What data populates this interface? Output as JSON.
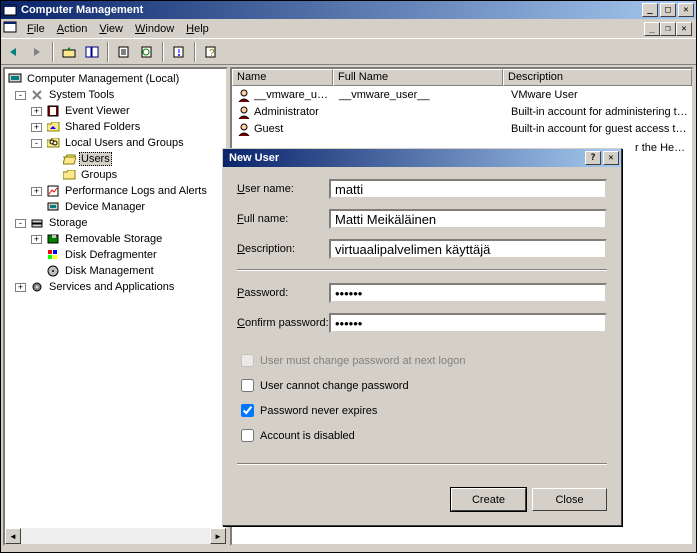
{
  "window": {
    "title": "Computer Management"
  },
  "menu": {
    "file": "File",
    "action": "Action",
    "view": "View",
    "window": "Window",
    "help": "Help"
  },
  "tree": {
    "root": "Computer Management (Local)",
    "system_tools": "System Tools",
    "event_viewer": "Event Viewer",
    "shared_folders": "Shared Folders",
    "local_users": "Local Users and Groups",
    "users": "Users",
    "groups": "Groups",
    "perf_logs": "Performance Logs and Alerts",
    "device_mgr": "Device Manager",
    "storage": "Storage",
    "removable": "Removable Storage",
    "defrag": "Disk Defragmenter",
    "diskmgmt": "Disk Management",
    "services": "Services and Applications"
  },
  "list": {
    "columns": {
      "name": "Name",
      "fullname": "Full Name",
      "description": "Description"
    },
    "rows": [
      {
        "name": "__vmware_u…",
        "fullname": "__vmware_user__",
        "desc": "VMware User"
      },
      {
        "name": "Administrator",
        "fullname": "",
        "desc": "Built-in account for administering the…"
      },
      {
        "name": "Guest",
        "fullname": "",
        "desc": "Built-in account for guest access to t…"
      }
    ],
    "hidden_desc": "r the He…"
  },
  "dialog": {
    "title": "New User",
    "labels": {
      "username": "User name:",
      "fullname": "Full name:",
      "description": "Description:",
      "password": "Password:",
      "confirm": "Confirm password:"
    },
    "values": {
      "username": "matti",
      "fullname": "Matti Meikäläinen",
      "description": "virtuaalipalvelimen käyttäjä",
      "password": "••••••",
      "confirm": "••••••"
    },
    "checks": {
      "must_change": "User must change password at next logon",
      "cannot_change": "User cannot change password",
      "never_expires": "Password never expires",
      "disabled": "Account is disabled"
    },
    "buttons": {
      "create": "Create",
      "close": "Close"
    }
  }
}
